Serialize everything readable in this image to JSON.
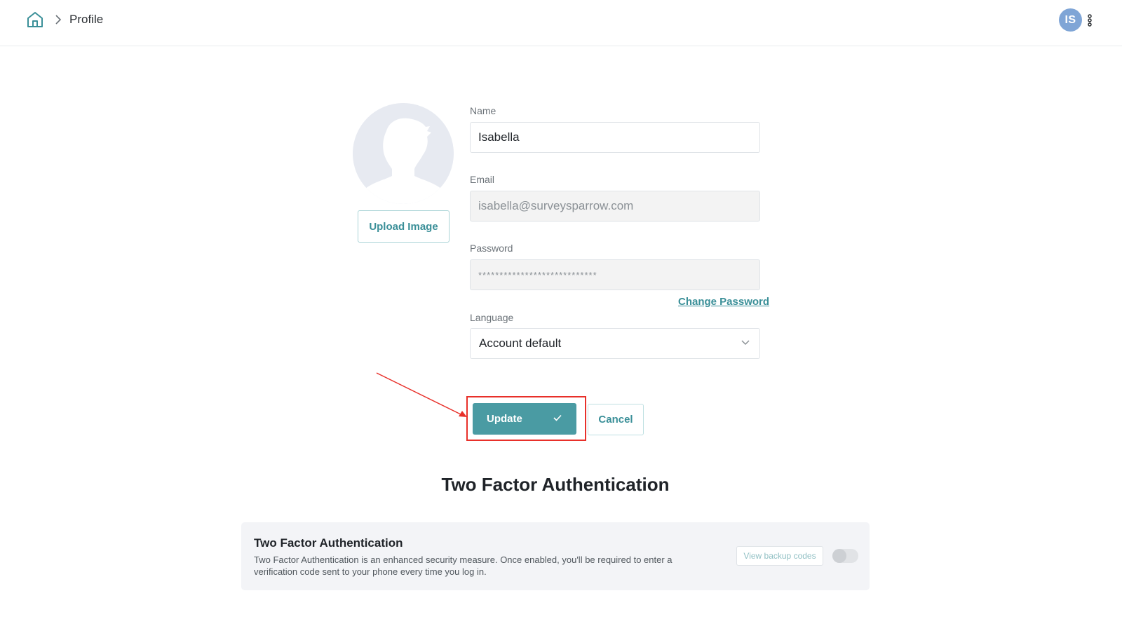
{
  "header": {
    "breadcrumb_title": "Profile",
    "user_initials": "IS",
    "home_icon": "home-icon",
    "separator_icon": "chevron-right-icon",
    "more_icon": "more-vertical-icon"
  },
  "profile": {
    "upload_label": "Upload Image",
    "name_label": "Name",
    "name_value": "Isabella",
    "email_label": "Email",
    "email_value": "isabella@surveysparrow.com",
    "password_label": "Password",
    "password_value": "****************************",
    "change_password_label": "Change Password",
    "language_label": "Language",
    "language_value": "Account default",
    "update_label": "Update",
    "cancel_label": "Cancel"
  },
  "two_factor": {
    "section_heading": "Two Factor Authentication",
    "card_title": "Two Factor Authentication",
    "card_description": "Two Factor Authentication is an enhanced security measure. Once enabled, you'll be required to enter a verification code sent to your phone every time you log in.",
    "backup_codes_label": "View backup codes",
    "enabled": false
  },
  "colors": {
    "accent": "#4a9ba3",
    "annotation": "#e8302a",
    "avatar": "#7fa5d6"
  }
}
